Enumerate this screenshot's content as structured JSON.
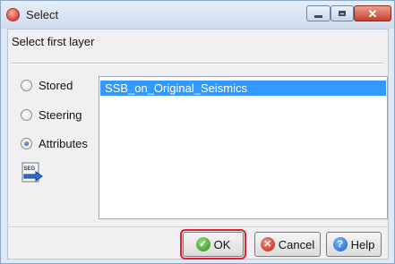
{
  "window": {
    "title": "Select"
  },
  "header": {
    "label": "Select first layer"
  },
  "options": [
    {
      "label": "Stored",
      "checked": false
    },
    {
      "label": "Steering",
      "checked": false
    },
    {
      "label": "Attributes",
      "checked": true
    }
  ],
  "list": {
    "items": [
      "SSB_on_Original_Seismics"
    ],
    "selected_index": 0
  },
  "buttons": {
    "ok": "OK",
    "cancel": "Cancel",
    "help": "Help"
  },
  "icons": {
    "app": "app-icon",
    "segy": "segy-import-icon",
    "ok": "check-icon",
    "cancel": "cancel-icon",
    "help": "help-icon"
  },
  "colors": {
    "selection": "#3399ff",
    "default_button_outline": "#e0202a"
  }
}
